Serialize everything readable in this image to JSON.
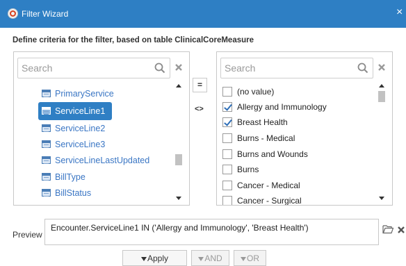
{
  "window": {
    "title": "Filter Wizard",
    "close_glyph": "×"
  },
  "subtitle": "Define criteria for the filter, based on table ClinicalCoreMeasure",
  "fields_panel": {
    "search_placeholder": "Search",
    "items": [
      {
        "label": "PrimaryService",
        "selected": false
      },
      {
        "label": "ServiceLine1",
        "selected": true
      },
      {
        "label": "ServiceLine2",
        "selected": false
      },
      {
        "label": "ServiceLine3",
        "selected": false
      },
      {
        "label": "ServiceLineLastUpdated",
        "selected": false
      },
      {
        "label": "BillType",
        "selected": false
      },
      {
        "label": "BillStatus",
        "selected": false
      }
    ]
  },
  "operators": {
    "current": "=",
    "alternate": "<>"
  },
  "values_panel": {
    "search_placeholder": "Search",
    "items": [
      {
        "label": "(no value)",
        "checked": false
      },
      {
        "label": "Allergy and Immunology",
        "checked": true
      },
      {
        "label": "Breast Health",
        "checked": true
      },
      {
        "label": "Burns - Medical",
        "checked": false
      },
      {
        "label": "Burns and Wounds",
        "checked": false
      },
      {
        "label": "Burns",
        "checked": false
      },
      {
        "label": "Cancer - Medical",
        "checked": false
      },
      {
        "label": "Cancer - Surgical",
        "checked": false
      }
    ]
  },
  "preview": {
    "label": "Preview",
    "value": "Encounter.ServiceLine1 IN ('Allergy and Immunology', 'Breast Health')"
  },
  "buttons": {
    "apply": "Apply",
    "and": "AND",
    "or": "OR"
  },
  "colors": {
    "titlebar": "#2e7fc4",
    "accent": "#2f7fc4",
    "link": "#3a76c4"
  }
}
